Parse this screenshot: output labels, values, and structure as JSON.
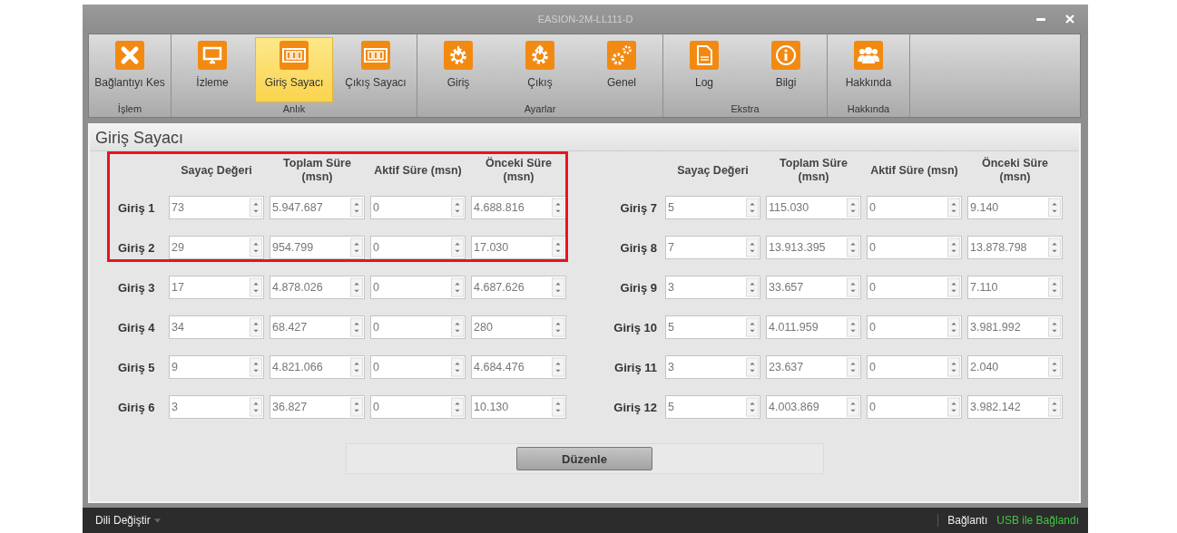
{
  "window": {
    "title": "EASION-2M-LL111-D"
  },
  "ribbon": {
    "groups": [
      {
        "label": "İşlem",
        "items": [
          {
            "label": "Bağlantıyı Kes",
            "kind": "close",
            "selected": false
          }
        ]
      },
      {
        "label": "Anlık",
        "items": [
          {
            "label": "İzleme",
            "kind": "monitor",
            "selected": false
          },
          {
            "label": "Giriş Sayacı",
            "kind": "counter",
            "selected": true
          },
          {
            "label": "Çıkış Sayacı",
            "kind": "counter",
            "selected": false
          }
        ]
      },
      {
        "label": "Ayarlar",
        "items": [
          {
            "label": "Giriş",
            "kind": "gearin",
            "selected": false
          },
          {
            "label": "Çıkış",
            "kind": "gearout",
            "selected": false
          },
          {
            "label": "Genel",
            "kind": "gears",
            "selected": false
          }
        ]
      },
      {
        "label": "Ekstra",
        "items": [
          {
            "label": "Log",
            "kind": "log",
            "selected": false
          },
          {
            "label": "Bilgi",
            "kind": "info",
            "selected": false
          }
        ]
      },
      {
        "label": "Hakkında",
        "items": [
          {
            "label": "Hakkında",
            "kind": "people",
            "selected": false
          }
        ]
      }
    ]
  },
  "section_title": "Giriş Sayacı",
  "tables": [
    {
      "columns": [
        "Sayaç Değeri",
        "Toplam Süre (msn)",
        "Aktif Süre (msn)",
        "Önceki Süre (msn)"
      ],
      "rows": [
        {
          "label": "Giriş 1",
          "values": [
            "73",
            "5.947.687",
            "0",
            "4.688.816"
          ]
        },
        {
          "label": "Giriş 2",
          "values": [
            "29",
            "954.799",
            "0",
            "17.030"
          ]
        },
        {
          "label": "Giriş 3",
          "values": [
            "17",
            "4.878.026",
            "0",
            "4.687.626"
          ]
        },
        {
          "label": "Giriş 4",
          "values": [
            "34",
            "68.427",
            "0",
            "280"
          ]
        },
        {
          "label": "Giriş 5",
          "values": [
            "9",
            "4.821.066",
            "0",
            "4.684.476"
          ]
        },
        {
          "label": "Giriş 6",
          "values": [
            "3",
            "36.827",
            "0",
            "10.130"
          ]
        }
      ]
    },
    {
      "columns": [
        "Sayaç Değeri",
        "Toplam Süre (msn)",
        "Aktif Süre (msn)",
        "Önceki Süre (msn)"
      ],
      "rows": [
        {
          "label": "Giriş 7",
          "values": [
            "5",
            "115.030",
            "0",
            "9.140"
          ]
        },
        {
          "label": "Giriş 8",
          "values": [
            "7",
            "13.913.395",
            "0",
            "13.878.798"
          ]
        },
        {
          "label": "Giriş 9",
          "values": [
            "3",
            "33.657",
            "0",
            "7.110"
          ]
        },
        {
          "label": "Giriş 10",
          "values": [
            "5",
            "4.011.959",
            "0",
            "3.981.992"
          ]
        },
        {
          "label": "Giriş 11",
          "values": [
            "3",
            "23.637",
            "0",
            "2.040"
          ]
        },
        {
          "label": "Giriş 12",
          "values": [
            "5",
            "4.003.869",
            "0",
            "3.982.142"
          ]
        }
      ]
    }
  ],
  "edit_button": "Düzenle",
  "status_bar": {
    "language": "Dili Değiştir",
    "connection_label": "Bağlantı",
    "connection_status": "USB ile Bağlandı"
  }
}
